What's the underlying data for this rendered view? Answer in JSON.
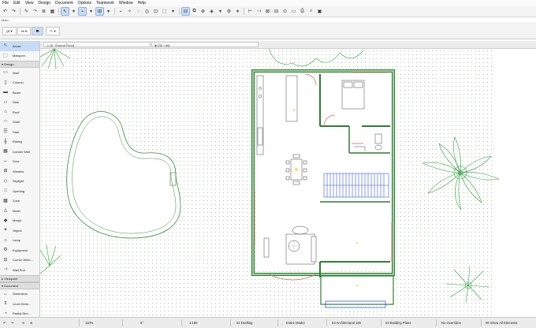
{
  "menubar": {
    "items": [
      "File",
      "Edit",
      "View",
      "Design",
      "Document",
      "Options",
      "Teamwork",
      "Window",
      "Help"
    ]
  },
  "toolbar": {
    "main_label": "Main"
  },
  "infobox": {
    "scale_value": "pt"
  },
  "toolbox": {
    "top_items": [
      {
        "label": "Arrow",
        "icon": "arrow-icon"
      },
      {
        "label": "Marquee",
        "icon": "marquee-icon"
      }
    ],
    "design_header": "Design",
    "design_items": [
      "Wall",
      "Column",
      "Beam",
      "Slab",
      "Roof",
      "Shell",
      "Stair",
      "Railing",
      "Curtain Wall",
      "Door",
      "Window",
      "Skylight",
      "Opening",
      "Zone",
      "Mesh",
      "Morph",
      "Object",
      "Lamp",
      "Equipment",
      "Corner Wind...",
      "Wall End"
    ],
    "viewpoint_header": "Viewpoint",
    "document_header": "Document",
    "document_items": [
      "Dimension",
      "Level Dime...",
      "Radial Dim..."
    ]
  },
  "tabs": {
    "floor_plan": "[0. Ground Floor]",
    "view_3d": "[3D / All]"
  },
  "statusbar": {
    "zoom": "110%",
    "angle": "0°",
    "scale": "1:100",
    "layer_combo": "02 Drafting",
    "model_view": "Entire Model",
    "pen_set": "03 Architectural 100",
    "plan_type": "03 Building Plans",
    "overrides": "No Overrides",
    "renovation": "00 Show All Elements"
  },
  "colors": {
    "accent": "#c9dcf3",
    "wall_green": "#2e7d32",
    "hatch_green": "#a9c9a4",
    "plant_green": "#3aa047",
    "stair_blue": "#3d5bd6",
    "door_red": "#d46a6a"
  }
}
